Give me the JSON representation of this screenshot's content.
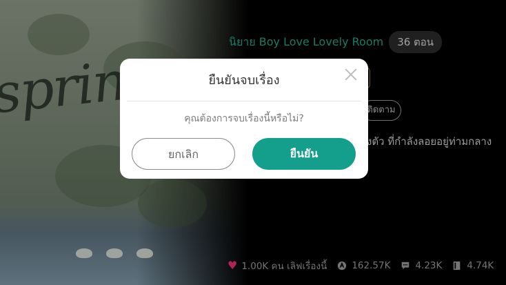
{
  "novel": {
    "title": "นิยาย Boy Love Lovely Room",
    "episodes": "36 ตอน",
    "follow_label": "ติดตาม",
    "description_snippet": "งตัว ที่กำลังลอยอยู่ท่ามกลาง"
  },
  "cover": {
    "script_text": "spring"
  },
  "stats": {
    "likes": "1.00K คน เลิฟเรื่องนี้",
    "views": "162.57K",
    "comments": "4.23K",
    "chapters": "4.74K"
  },
  "dialog": {
    "title": "ยืนยันจบเรื่อง",
    "message": "คุณต้องการจบเรื่องนี้หรือไม่?",
    "cancel_label": "ยกเลิก",
    "confirm_label": "ยืนยัน"
  },
  "colors": {
    "accent": "#139f8b",
    "title_teal": "#22a58b",
    "heart": "#e8316e"
  }
}
